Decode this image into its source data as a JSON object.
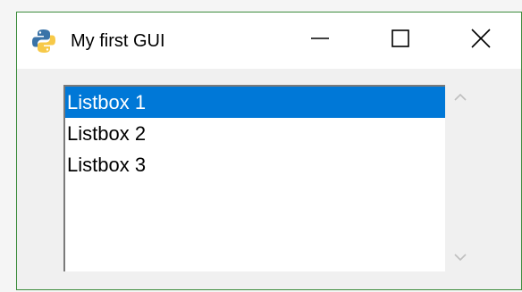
{
  "window": {
    "title": "My first GUI",
    "app_icon": "python-icon",
    "controls": {
      "minimize_icon": "minimize-icon",
      "maximize_icon": "maximize-icon",
      "close_icon": "close-icon"
    }
  },
  "listbox": {
    "items": [
      {
        "label": "Listbox 1",
        "selected": true
      },
      {
        "label": "Listbox 2",
        "selected": false
      },
      {
        "label": "Listbox 3",
        "selected": false
      }
    ]
  },
  "scrollbar": {
    "up_icon": "chevron-up-icon",
    "down_icon": "chevron-down-icon"
  },
  "colors": {
    "selection": "#0078d7",
    "window_border": "#3c8c3c",
    "client_background": "#f0f0f0"
  }
}
